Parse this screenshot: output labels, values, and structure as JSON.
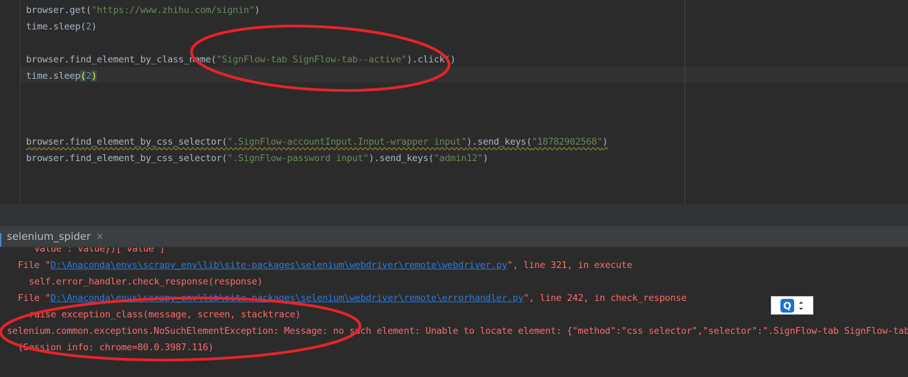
{
  "editor": {
    "lines": [
      {
        "segments": [
          {
            "t": "browser.get("
          },
          {
            "t": "\"https://www.zhihu.com/signin\"",
            "c": "str"
          },
          {
            "t": ")"
          }
        ]
      },
      {
        "segments": [
          {
            "t": "time.sleep("
          },
          {
            "t": "2",
            "c": "num"
          },
          {
            "t": ")"
          }
        ]
      },
      {
        "segments": []
      },
      {
        "segments": [
          {
            "t": "browser.find_element_by_class_name("
          },
          {
            "t": "\"SignFlow-tab SignFlow-tab--active\"",
            "c": "str"
          },
          {
            "t": ").click()"
          }
        ]
      },
      {
        "segments": [
          {
            "t": "time.sleep"
          },
          {
            "t": "(",
            "c": "paren-hl"
          },
          {
            "t": "2",
            "c": "num"
          },
          {
            "t": ")",
            "c": "paren-hl"
          }
        ]
      },
      {
        "segments": []
      },
      {
        "segments": []
      },
      {
        "segments": []
      },
      {
        "segments": [
          {
            "t": "browser.find_element_by_css_selector(",
            "c": "squiggle"
          },
          {
            "t": "\".SignFlow-accountInput.Input-wrapper input\"",
            "c": "str squiggle"
          },
          {
            "t": ").send_keys(",
            "c": "squiggle"
          },
          {
            "t": "\"18782902568\"",
            "c": "str squiggle"
          },
          {
            "t": ")",
            "c": "squiggle"
          }
        ]
      },
      {
        "segments": [
          {
            "t": "browser.find_element_by_css_selector("
          },
          {
            "t": "\".SignFlow-password input\"",
            "c": "str"
          },
          {
            "t": ").send_keys("
          },
          {
            "t": "\"admin12\"",
            "c": "str"
          },
          {
            "t": ")"
          }
        ]
      }
    ]
  },
  "run_panel": {
    "tab_label": "selenium_spider",
    "close_glyph": "×"
  },
  "console": {
    "lines": [
      {
        "indent": 50,
        "segments": [
          {
            "t": "value : value})['value']"
          }
        ]
      },
      {
        "indent": 26,
        "segments": [
          {
            "t": "File \""
          },
          {
            "t": "D:\\Anaconda\\envs\\scrapy_env\\lib\\site-packages\\selenium\\webdriver\\remote\\webdriver.py",
            "c": "link"
          },
          {
            "t": "\", line 321, in execute"
          }
        ]
      },
      {
        "indent": 42,
        "segments": [
          {
            "t": "self.error_handler.check_response(response)"
          }
        ]
      },
      {
        "indent": 26,
        "segments": [
          {
            "t": "File \""
          },
          {
            "t": "D:\\Anaconda\\envs\\scrapy_env\\lib\\site-packages\\selenium\\webdriver\\remote\\errorhandler.py",
            "c": "link"
          },
          {
            "t": "\", line 242, in check_response"
          }
        ]
      },
      {
        "indent": 42,
        "segments": [
          {
            "t": "raise exception_class(message, screen, stacktrace)"
          }
        ]
      },
      {
        "indent": 10,
        "segments": [
          {
            "t": "selenium.common.exceptions.NoSuchElementException: Message: no such element: Unable to locate element: {\"method\":\"css selector\",\"selector\":\".SignFlow-tab SignFlow-tab--active\"}"
          }
        ]
      },
      {
        "indent": 26,
        "segments": [
          {
            "t": "(Session info: chrome=80.0.3987.116)"
          }
        ]
      }
    ]
  },
  "colors": {
    "annotation": "#e8232a",
    "tab_accent": "#4a88c7",
    "widget_icon": "#1a6fd6"
  },
  "widget": {
    "icon": "Q"
  }
}
